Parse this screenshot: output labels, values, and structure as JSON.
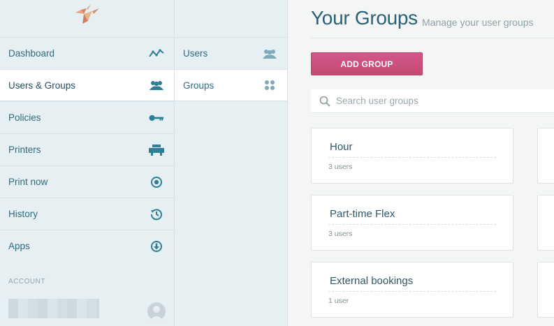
{
  "colors": {
    "accent": "#c94d7b",
    "nav_text": "#2f6b80",
    "sidebar_bg": "#e6f0f2"
  },
  "sidebar": {
    "items": [
      {
        "label": "Dashboard",
        "icon": "activity-icon"
      },
      {
        "label": "Users & Groups",
        "icon": "users-icon",
        "active": true
      },
      {
        "label": "Policies",
        "icon": "key-icon"
      },
      {
        "label": "Printers",
        "icon": "printer-icon"
      },
      {
        "label": "Print now",
        "icon": "target-icon"
      },
      {
        "label": "History",
        "icon": "history-icon"
      },
      {
        "label": "Apps",
        "icon": "download-icon"
      }
    ],
    "account_label": "ACCOUNT"
  },
  "subnav": {
    "items": [
      {
        "label": "Users",
        "icon": "users-icon"
      },
      {
        "label": "Groups",
        "icon": "grid-dots-icon",
        "active": true
      }
    ]
  },
  "main": {
    "title": "Your Groups",
    "subtitle": "Manage your user groups",
    "add_button": "ADD GROUP",
    "search_placeholder": "Search user groups",
    "groups": [
      {
        "name": "Hour",
        "count": "3 users"
      },
      {
        "name": "Part-time Flex",
        "count": "3 users"
      },
      {
        "name": "External bookings",
        "count": "1 user"
      }
    ]
  }
}
